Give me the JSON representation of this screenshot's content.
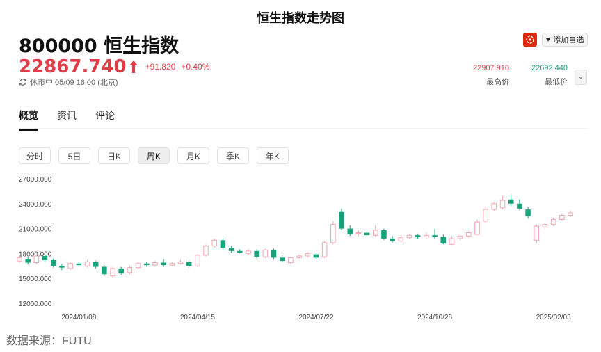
{
  "page_title": "恒生指数走势图",
  "header": {
    "stock_name": "800000 恒生指数",
    "price": "22867.740",
    "change": "+91.820",
    "change_pct": "+0.40%",
    "status": "休市中 05/09 16:00 (北京)",
    "follow_label": "添加自选",
    "high_value": "22907.910",
    "high_label": "最高价",
    "low_value": "22692.440",
    "low_label": "最低价"
  },
  "tabs": [
    {
      "label": "概览",
      "active": true
    },
    {
      "label": "资讯",
      "active": false
    },
    {
      "label": "评论",
      "active": false
    }
  ],
  "periods": [
    {
      "label": "分时",
      "active": false
    },
    {
      "label": "5日",
      "active": false
    },
    {
      "label": "日K",
      "active": false
    },
    {
      "label": "周K",
      "active": true
    },
    {
      "label": "月K",
      "active": false
    },
    {
      "label": "季K",
      "active": false
    },
    {
      "label": "年K",
      "active": false
    }
  ],
  "colors": {
    "up": "#f2a5ae",
    "down": "#1aa37a",
    "price": "#e03c48",
    "low": "#1aa37a"
  },
  "source": "数据来源：FUTU",
  "chart_data": {
    "type": "candlestick",
    "title": "",
    "xlabel": "",
    "ylabel": "",
    "ylim": [
      12000,
      27000
    ],
    "yticks": [
      "27000.000",
      "24000.000",
      "21000.000",
      "18000.000",
      "15000.000",
      "12000.000"
    ],
    "ytick_values": [
      27000,
      24000,
      21000,
      18000,
      15000,
      12000
    ],
    "xticks": [
      "2024/01/08",
      "2024/04/15",
      "2024/07/22",
      "2024/10/28",
      "2025/02/03"
    ],
    "xtick_index": [
      7,
      21,
      35,
      49,
      63
    ],
    "candles": [
      [
        17100,
        17500,
        16900,
        17700
      ],
      [
        17300,
        16900,
        16700,
        17600
      ],
      [
        16900,
        17700,
        16700,
        17900
      ],
      [
        17700,
        17200,
        17000,
        17900
      ],
      [
        17200,
        16500,
        16300,
        17400
      ],
      [
        16500,
        16300,
        16000,
        16700
      ],
      [
        16200,
        16800,
        16000,
        17000
      ],
      [
        16800,
        16600,
        16400,
        17000
      ],
      [
        16500,
        17000,
        16300,
        17200
      ],
      [
        17000,
        16400,
        16200,
        17100
      ],
      [
        16400,
        15500,
        15300,
        16600
      ],
      [
        15300,
        16200,
        15000,
        16400
      ],
      [
        16200,
        15600,
        15400,
        16400
      ],
      [
        15700,
        16300,
        15500,
        16500
      ],
      [
        16300,
        16800,
        16100,
        17000
      ],
      [
        16800,
        16600,
        16400,
        17000
      ],
      [
        16600,
        16900,
        16400,
        17100
      ],
      [
        16900,
        16600,
        16400,
        17300
      ],
      [
        16600,
        16800,
        16500,
        17000
      ],
      [
        16800,
        17000,
        16700,
        17200
      ],
      [
        17000,
        16500,
        16300,
        17200
      ],
      [
        16500,
        17800,
        16400,
        17900
      ],
      [
        17800,
        18900,
        17600,
        19100
      ],
      [
        18900,
        19600,
        18700,
        19800
      ],
      [
        19600,
        18700,
        18500,
        19800
      ],
      [
        18700,
        18300,
        18100,
        18900
      ],
      [
        18300,
        18100,
        18000,
        18500
      ],
      [
        18000,
        18300,
        17800,
        18500
      ],
      [
        18300,
        17600,
        17400,
        18500
      ],
      [
        17600,
        18400,
        17400,
        18600
      ],
      [
        18400,
        17500,
        17300,
        18600
      ],
      [
        17500,
        17100,
        17000,
        17800
      ],
      [
        16900,
        17500,
        16700,
        17600
      ],
      [
        17500,
        17700,
        17300,
        17900
      ],
      [
        17700,
        18000,
        17500,
        18200
      ],
      [
        17900,
        17500,
        17300,
        18100
      ],
      [
        17600,
        19300,
        17400,
        19500
      ],
      [
        19300,
        21500,
        19100,
        21900
      ],
      [
        23000,
        21000,
        20800,
        23400
      ],
      [
        21000,
        20300,
        20100,
        21400
      ],
      [
        20400,
        20500,
        20100,
        20800
      ],
      [
        20500,
        20200,
        20000,
        20700
      ],
      [
        20200,
        20800,
        20000,
        21400
      ],
      [
        20800,
        19800,
        19600,
        21000
      ],
      [
        19800,
        19500,
        19300,
        20100
      ],
      [
        19500,
        19900,
        19300,
        20200
      ],
      [
        19900,
        20200,
        19700,
        20400
      ],
      [
        20200,
        20000,
        19800,
        20400
      ],
      [
        20000,
        20200,
        19800,
        20500
      ],
      [
        20200,
        20000,
        19800,
        21000
      ],
      [
        20000,
        19200,
        19100,
        20300
      ],
      [
        19100,
        19800,
        19000,
        20100
      ],
      [
        19800,
        20100,
        19600,
        20300
      ],
      [
        20100,
        20500,
        19900,
        20700
      ],
      [
        20300,
        21800,
        20200,
        22100
      ],
      [
        21900,
        23300,
        21700,
        23600
      ],
      [
        23300,
        24000,
        23100,
        24200
      ],
      [
        23500,
        24400,
        23300,
        24900
      ],
      [
        24500,
        24000,
        23700,
        25100
      ],
      [
        24000,
        23400,
        23200,
        24500
      ],
      [
        23300,
        22500,
        22200,
        23600
      ],
      [
        19600,
        21300,
        19200,
        21500
      ],
      [
        21200,
        21500,
        21000,
        21700
      ],
      [
        21500,
        22100,
        21300,
        22300
      ],
      [
        22100,
        22600,
        21900,
        22800
      ],
      [
        22600,
        22900,
        22400,
        23100
      ]
    ]
  }
}
